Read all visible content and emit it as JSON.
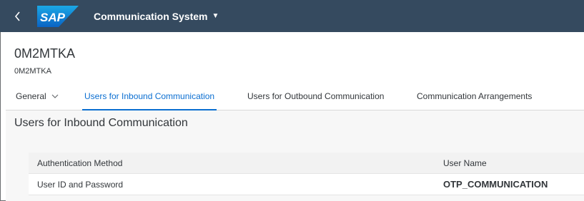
{
  "shell": {
    "back_icon": "chevron-left-icon",
    "logo_text": "SAP",
    "app_title": "Communication System",
    "title_menu_icon": "caret-down-icon",
    "colors": {
      "shell_bg": "#354a5f",
      "logo_blue": "#0a6ed1",
      "accent": "#0a6ed1"
    }
  },
  "header": {
    "title": "0M2MTKA",
    "subtitle": "0M2MTKA"
  },
  "tabs": [
    {
      "label": "General",
      "active": false,
      "has_dropdown": true
    },
    {
      "label": "Users for Inbound Communication",
      "active": true
    },
    {
      "label": "Users for Outbound Communication",
      "active": false
    },
    {
      "label": "Communication Arrangements",
      "active": false
    }
  ],
  "section": {
    "title": "Users for Inbound Communication",
    "table": {
      "columns": [
        "Authentication Method",
        "User Name"
      ],
      "rows": [
        [
          "User ID and Password",
          "OTP_COMMUNICATION"
        ]
      ]
    }
  }
}
